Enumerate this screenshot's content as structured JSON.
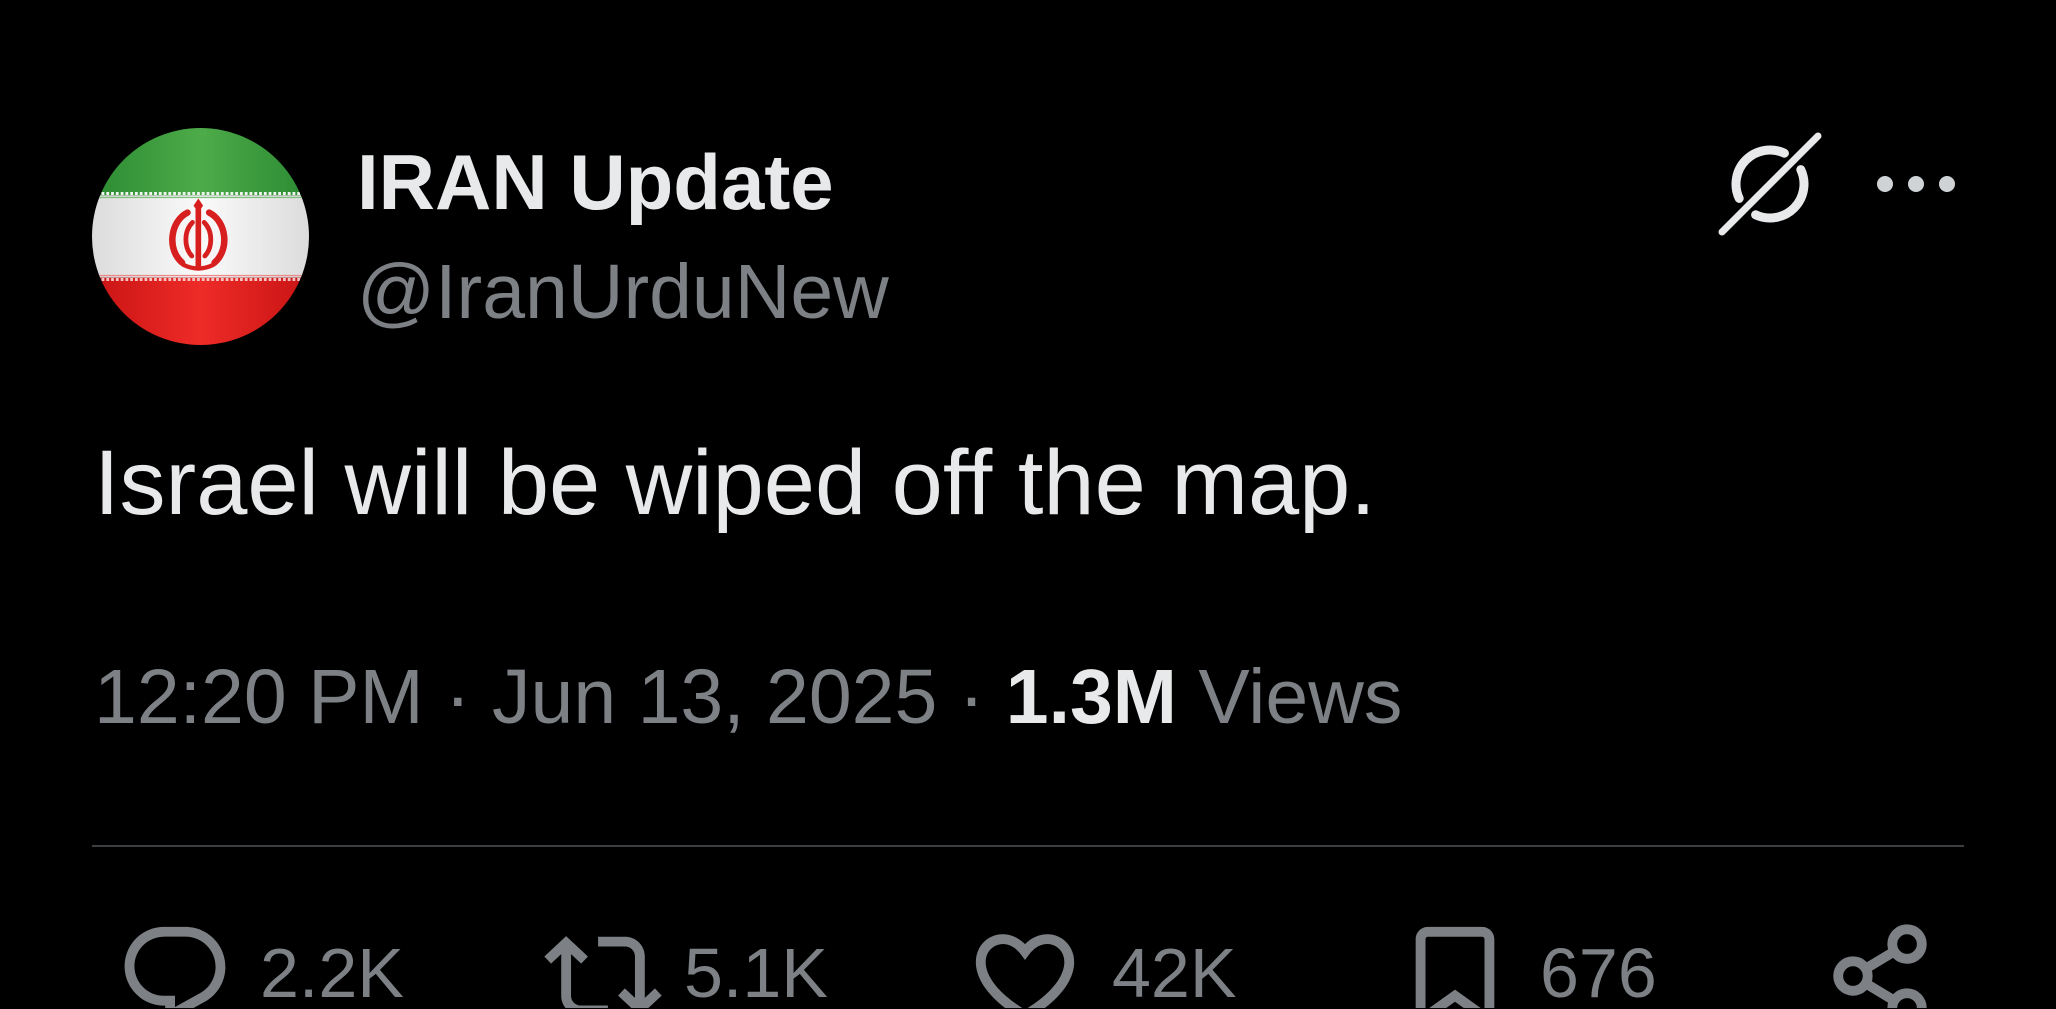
{
  "tweet": {
    "author": {
      "display_name": "IRAN Update",
      "handle": "@IranUrduNew",
      "avatar_icon": "iran-flag-avatar-icon"
    },
    "header_icons": {
      "grok": "grok-icon",
      "more": "more-icon"
    },
    "text": "Israel will be wiped off the map.",
    "meta": {
      "time": "12:20 PM",
      "separator": "·",
      "date": "Jun 13, 2025",
      "views_count": "1.3M",
      "views_label": "Views"
    },
    "actions": [
      {
        "name": "reply",
        "icon": "reply-icon",
        "count": "2.2K"
      },
      {
        "name": "retweet",
        "icon": "retweet-icon",
        "count": "5.1K"
      },
      {
        "name": "like",
        "icon": "heart-icon",
        "count": "42K"
      },
      {
        "name": "bookmark",
        "icon": "bookmark-icon",
        "count": "676"
      },
      {
        "name": "share",
        "icon": "share-icon"
      }
    ]
  },
  "colors": {
    "background": "#000000",
    "text_primary": "#e7e9ea",
    "text_secondary": "#7d8185",
    "divider": "#3c3f42",
    "flag_green": "#3a9c3e",
    "flag_white": "#f3f3f3",
    "flag_red": "#dd1f1d"
  }
}
